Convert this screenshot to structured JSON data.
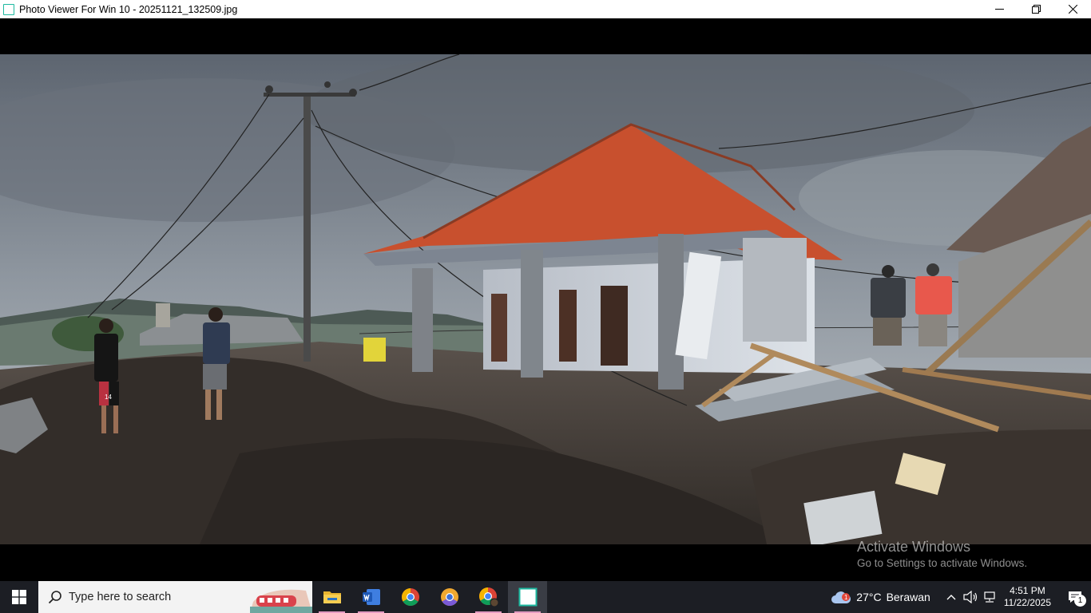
{
  "window": {
    "title": "Photo Viewer For Win 10 - 20251121_132509.jpg",
    "app_icon": "photo-viewer-icon",
    "controls": [
      "minimize-icon",
      "maximize-icon",
      "close-icon"
    ]
  },
  "photo": {
    "filename": "20251121_132509.jpg",
    "shirt_number": "14"
  },
  "watermark": {
    "line1": "Activate Windows",
    "line2": "Go to Settings to activate Windows."
  },
  "taskbar": {
    "search_placeholder": "Type here to search",
    "apps": [
      "file-explorer-icon",
      "word-icon",
      "chrome-icon",
      "chrome-beta-icon",
      "chrome-profile-icon",
      "photo-viewer-icon"
    ],
    "weather": {
      "temp": "27°C",
      "condition": "Berawan",
      "alert_count": "1"
    },
    "clock": {
      "time": "4:51 PM",
      "date": "11/22/2025"
    },
    "notification_count": "1"
  },
  "colors": {
    "accent": "#1db9a0",
    "roof": "#c8502e",
    "taskbar": "#1c1e24"
  }
}
